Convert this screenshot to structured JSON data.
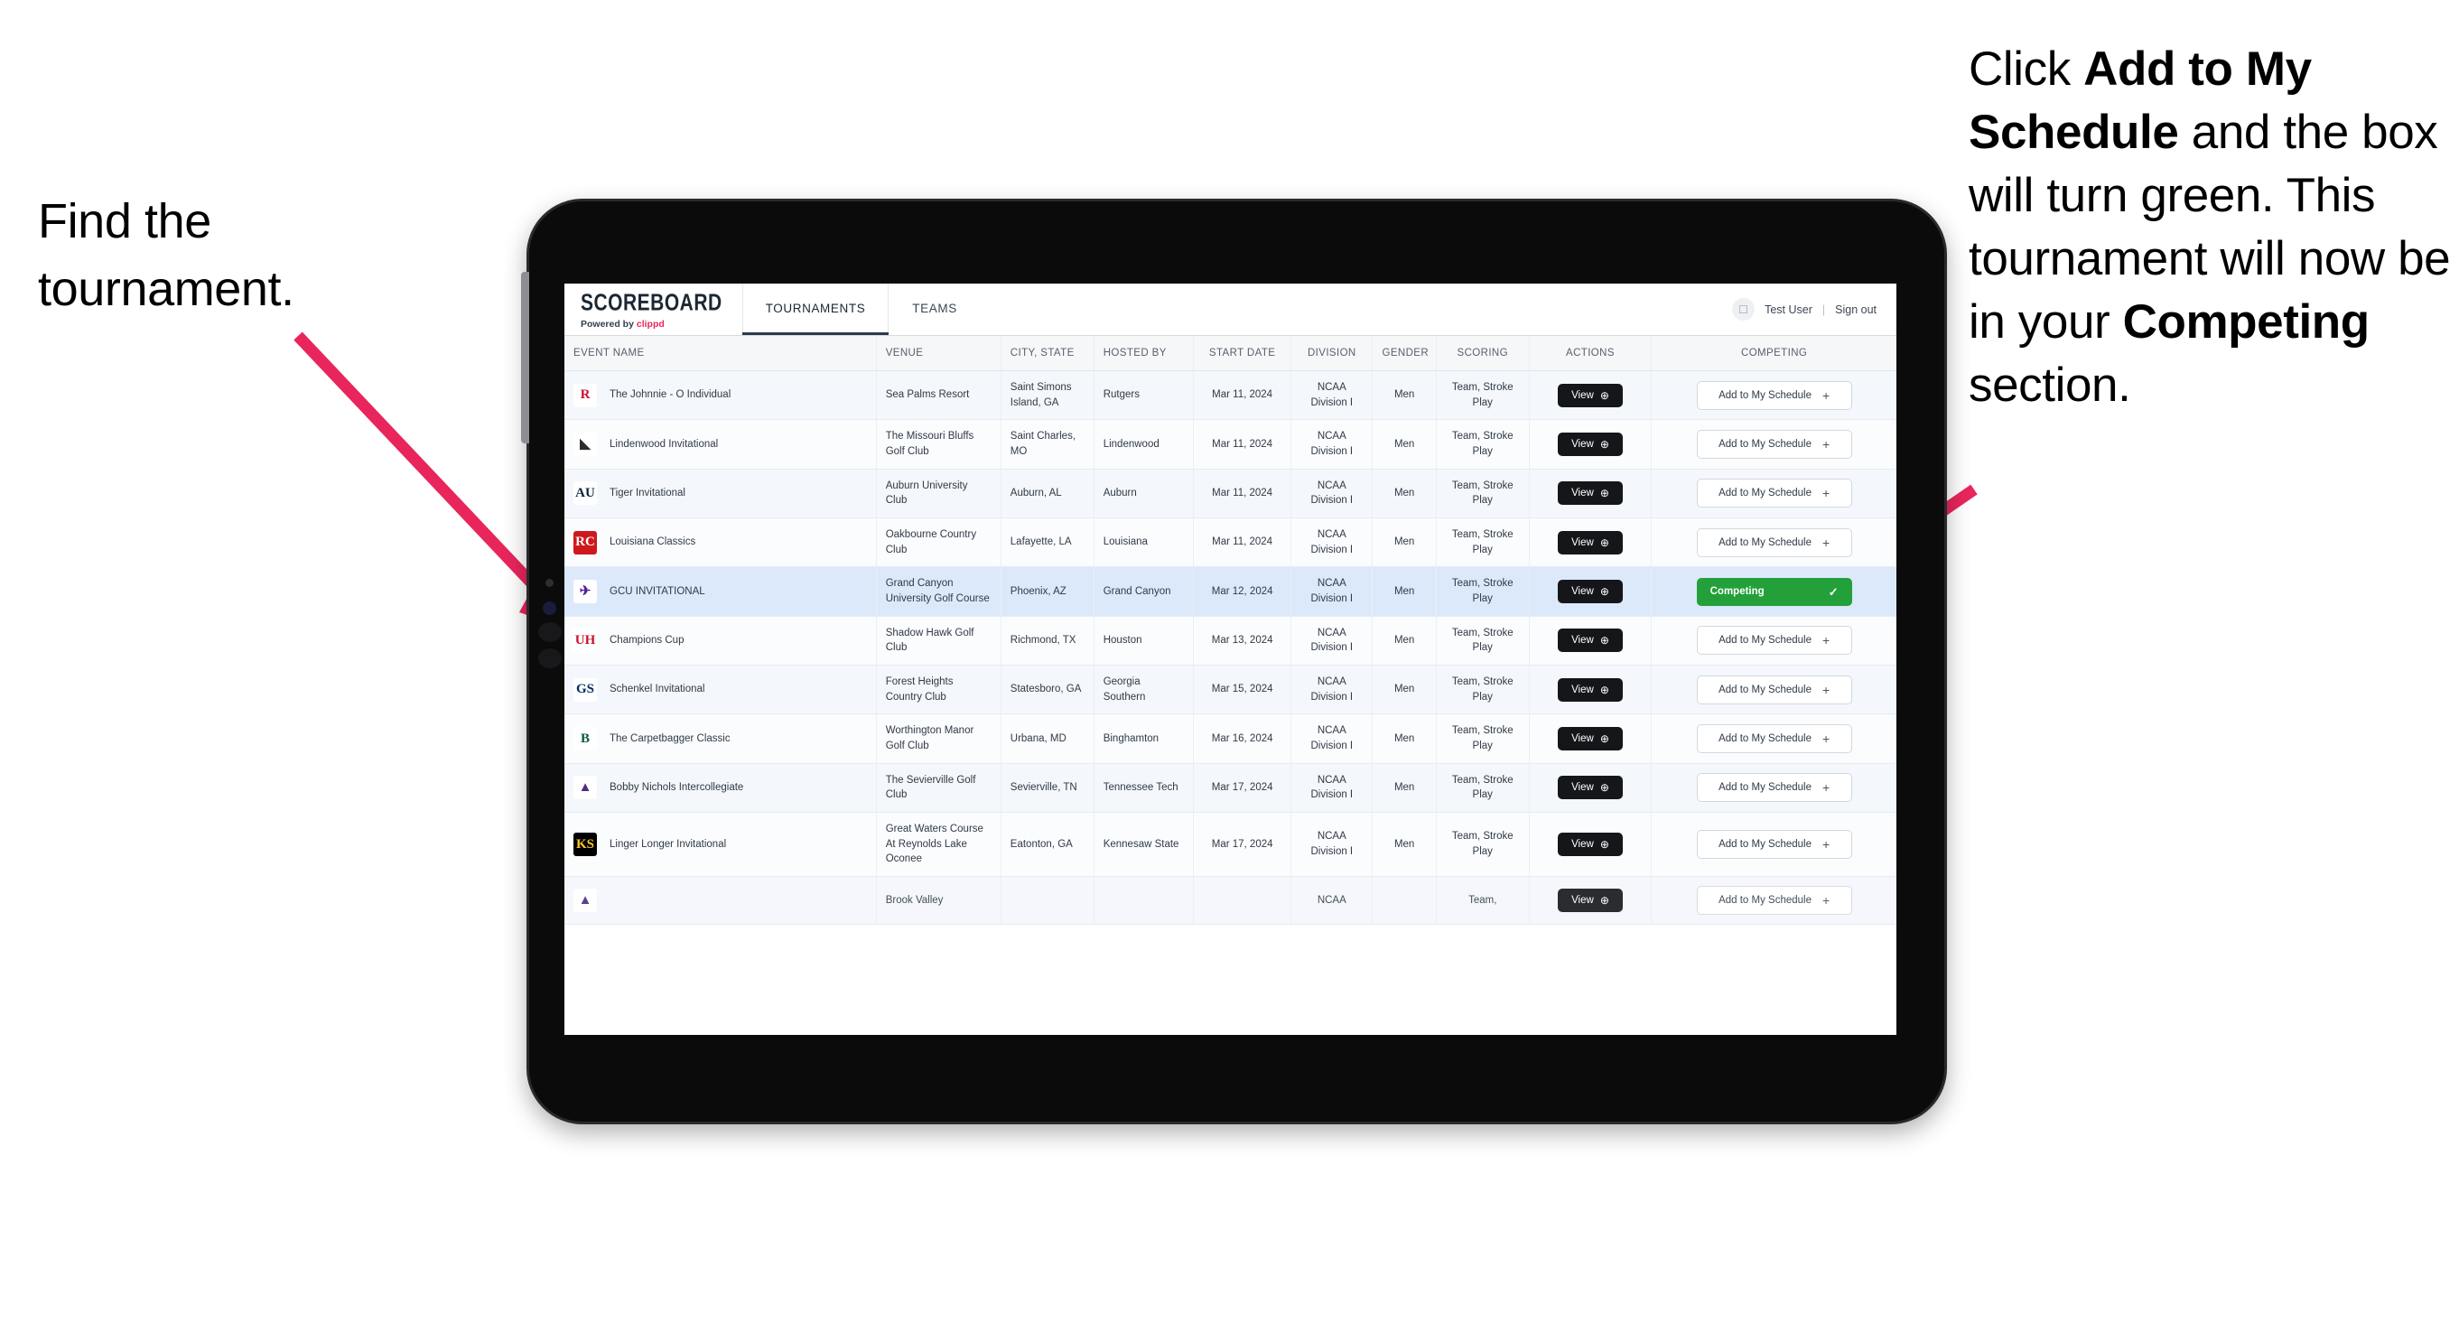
{
  "annotations": {
    "left": "Find the tournament.",
    "right_parts": [
      {
        "text": "Click ",
        "bold": false
      },
      {
        "text": "Add to My Schedule",
        "bold": true
      },
      {
        "text": " and the box will turn green. This tournament will now be in your ",
        "bold": false
      },
      {
        "text": "Competing",
        "bold": true
      },
      {
        "text": " section.",
        "bold": false
      }
    ],
    "arrow_color": "#e8265c"
  },
  "app": {
    "brand": {
      "title": "SCOREBOARD",
      "powered_prefix": "Powered by ",
      "powered_name": "clippd"
    },
    "nav": [
      {
        "label": "TOURNAMENTS",
        "active": true
      },
      {
        "label": "TEAMS",
        "active": false
      }
    ],
    "user": {
      "avatar_icon": "user-avatar-icon",
      "name": "Test User",
      "separator": "|",
      "signout": "Sign out"
    }
  },
  "table": {
    "columns": [
      "EVENT NAME",
      "VENUE",
      "CITY, STATE",
      "HOSTED BY",
      "START DATE",
      "DIVISION",
      "GENDER",
      "SCORING",
      "ACTIONS",
      "COMPETING"
    ],
    "action_labels": {
      "view": "View",
      "view_icon": "circle-arrow-right-icon",
      "add": "Add to My Schedule",
      "add_icon": "plus-icon",
      "competing": "Competing",
      "competing_icon": "check-icon"
    },
    "colors": {
      "competing_green": "#23a03a",
      "selected_row": "#dce9fb",
      "view_button": "#15161a"
    },
    "rows": [
      {
        "event": "The Johnnie - O Individual",
        "logo_text": "R",
        "logo_fg": "#c8102e",
        "logo_bg": "#ffffff",
        "venue": "Sea Palms Resort",
        "city": "Saint Simons Island, GA",
        "hosted_by": "Rutgers",
        "start_date": "Mar 11, 2024",
        "division": "NCAA Division I",
        "gender": "Men",
        "scoring": "Team, Stroke Play",
        "competing": false
      },
      {
        "event": "Lindenwood Invitational",
        "logo_text": "◣",
        "logo_fg": "#2b2b2b",
        "logo_bg": "#ffffff",
        "venue": "The Missouri Bluffs Golf Club",
        "city": "Saint Charles, MO",
        "hosted_by": "Lindenwood",
        "start_date": "Mar 11, 2024",
        "division": "NCAA Division I",
        "gender": "Men",
        "scoring": "Team, Stroke Play",
        "competing": false
      },
      {
        "event": "Tiger Invitational",
        "logo_text": "AU",
        "logo_fg": "#0c2340",
        "logo_bg": "#ffffff",
        "venue": "Auburn University Club",
        "city": "Auburn, AL",
        "hosted_by": "Auburn",
        "start_date": "Mar 11, 2024",
        "division": "NCAA Division I",
        "gender": "Men",
        "scoring": "Team, Stroke Play",
        "competing": false
      },
      {
        "event": "Louisiana Classics",
        "logo_text": "RC",
        "logo_fg": "#ffffff",
        "logo_bg": "#ce181e",
        "venue": "Oakbourne Country Club",
        "city": "Lafayette, LA",
        "hosted_by": "Louisiana",
        "start_date": "Mar 11, 2024",
        "division": "NCAA Division I",
        "gender": "Men",
        "scoring": "Team, Stroke Play",
        "competing": false
      },
      {
        "event": "GCU INVITATIONAL",
        "logo_text": "✈",
        "logo_fg": "#522398",
        "logo_bg": "#ffffff",
        "venue": "Grand Canyon University Golf Course",
        "city": "Phoenix, AZ",
        "hosted_by": "Grand Canyon",
        "start_date": "Mar 12, 2024",
        "division": "NCAA Division I",
        "gender": "Men",
        "scoring": "Team, Stroke Play",
        "competing": true
      },
      {
        "event": "Champions Cup",
        "logo_text": "UH",
        "logo_fg": "#c8102e",
        "logo_bg": "#ffffff",
        "venue": "Shadow Hawk Golf Club",
        "city": "Richmond, TX",
        "hosted_by": "Houston",
        "start_date": "Mar 13, 2024",
        "division": "NCAA Division I",
        "gender": "Men",
        "scoring": "Team, Stroke Play",
        "competing": false
      },
      {
        "event": "Schenkel Invitational",
        "logo_text": "GS",
        "logo_fg": "#002d62",
        "logo_bg": "#ffffff",
        "venue": "Forest Heights Country Club",
        "city": "Statesboro, GA",
        "hosted_by": "Georgia Southern",
        "start_date": "Mar 15, 2024",
        "division": "NCAA Division I",
        "gender": "Men",
        "scoring": "Team, Stroke Play",
        "competing": false
      },
      {
        "event": "The Carpetbagger Classic",
        "logo_text": "B",
        "logo_fg": "#005a43",
        "logo_bg": "#ffffff",
        "venue": "Worthington Manor Golf Club",
        "city": "Urbana, MD",
        "hosted_by": "Binghamton",
        "start_date": "Mar 16, 2024",
        "division": "NCAA Division I",
        "gender": "Men",
        "scoring": "Team, Stroke Play",
        "competing": false
      },
      {
        "event": "Bobby Nichols Intercollegiate",
        "logo_text": "▲",
        "logo_fg": "#502d7f",
        "logo_bg": "#ffffff",
        "venue": "The Sevierville Golf Club",
        "city": "Sevierville, TN",
        "hosted_by": "Tennessee Tech",
        "start_date": "Mar 17, 2024",
        "division": "NCAA Division I",
        "gender": "Men",
        "scoring": "Team, Stroke Play",
        "competing": false
      },
      {
        "event": "Linger Longer Invitational",
        "logo_text": "KS",
        "logo_fg": "#ffc629",
        "logo_bg": "#000000",
        "venue": "Great Waters Course At Reynolds Lake Oconee",
        "city": "Eatonton, GA",
        "hosted_by": "Kennesaw State",
        "start_date": "Mar 17, 2024",
        "division": "NCAA Division I",
        "gender": "Men",
        "scoring": "Team, Stroke Play",
        "competing": false
      },
      {
        "event": "",
        "logo_text": "▲",
        "logo_fg": "#4b2e83",
        "logo_bg": "#ffffff",
        "venue": "Brook Valley",
        "city": "",
        "hosted_by": "",
        "start_date": "",
        "division": "NCAA",
        "gender": "",
        "scoring": "Team,",
        "competing": false,
        "partial": true
      }
    ]
  }
}
